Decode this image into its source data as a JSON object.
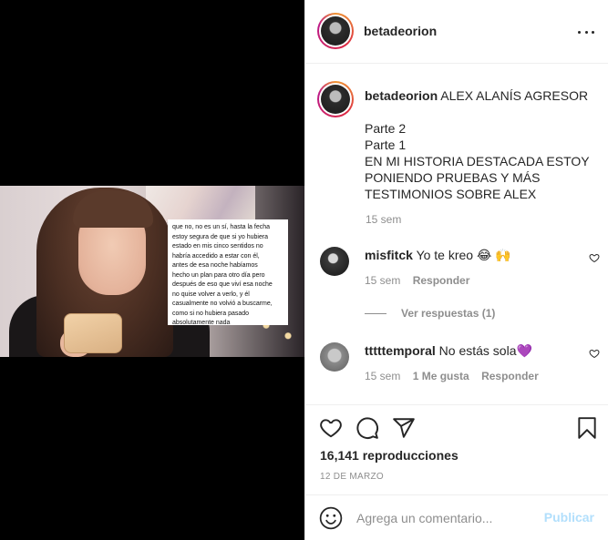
{
  "post": {
    "username": "betadeorion",
    "more_icon": "more-horizontal-icon",
    "caption_title": "ALEX ALANÍS AGRESOR",
    "caption_lines": [
      "Parte 2",
      "Parte 1",
      "EN MI HISTORIA DESTACADA ESTOY",
      "PONIENDO PRUEBAS Y MÁS",
      "TESTIMONIOS SOBRE ALEX"
    ],
    "caption_time": "15 sem"
  },
  "video": {
    "overlay_lines": [
      "que no, no es un sí, hasta la fecha",
      "estoy segura de que si yo hubiera",
      "estado en mis cinco sentidos no",
      "habría accedido a estar con él,",
      "antes de esa noche habíamos",
      "hecho un plan para otro día pero",
      "después de eso que viví esa noche",
      "no quise volver a verlo, y él",
      "casualmente no volvió a buscarme,",
      "como si no hubiera pasado",
      "absolutamente nada"
    ]
  },
  "comments": [
    {
      "username": "misfitck",
      "text": "Yo te kreo 😂 🙌",
      "time": "15 sem",
      "likes": "",
      "reply_label": "Responder",
      "view_replies": "Ver respuestas (1)"
    },
    {
      "username": "tttttemporal",
      "text": "No estás sola💜",
      "time": "15 sem",
      "likes": "1 Me gusta",
      "reply_label": "Responder"
    }
  ],
  "actions": {
    "views": "16,141 reproducciones",
    "date": "12 DE MARZO"
  },
  "add_comment": {
    "placeholder": "Agrega un comentario...",
    "publish_label": "Publicar"
  },
  "colors": {
    "text": "#262626",
    "muted": "#8e8e8e",
    "publish_disabled": "#b2dffc",
    "border": "#efefef"
  }
}
